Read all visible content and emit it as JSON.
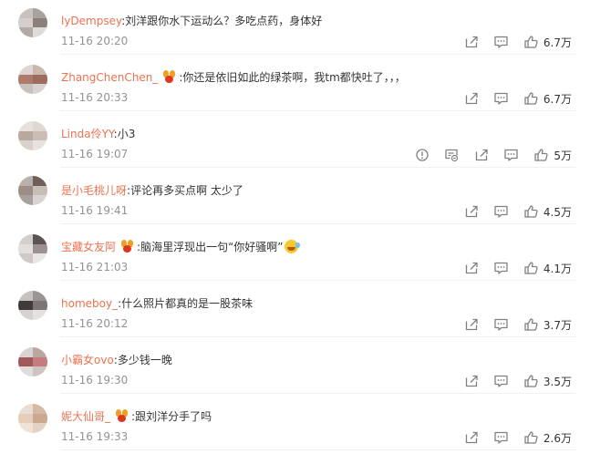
{
  "colors": {
    "username": "#eb7350",
    "text": "#333333",
    "time": "#939393",
    "icon": "#808080"
  },
  "comments": [
    {
      "username": "lyDempsey",
      "text": "刘洋跟你水下运动么？多吃点药，身体好",
      "time": "11-16 20:20",
      "likes": "6.7万",
      "badge": false,
      "avatar_colors": [
        "#c8c2bf",
        "#a9a19d",
        "#d4cfcc",
        "#8b807a",
        "#b3aaa5",
        "#e0dcd9"
      ]
    },
    {
      "username": "ZhangChenChen_",
      "text": "你还是依旧如此的绿茶啊，我tm都快吐了，，，",
      "time": "11-16 20:33",
      "likes": "6.7万",
      "badge": true,
      "avatar_colors": [
        "#ddd6d2",
        "#c9b8ad",
        "#b07a6a",
        "#9d6c5e",
        "#c7c1bd",
        "#d8d3d0"
      ]
    },
    {
      "username": "Linda伶YY",
      "text": "小3",
      "time": "11-16 19:07",
      "likes": "5万",
      "badge": false,
      "extra_actions": [
        "report-icon",
        "edit-icon"
      ],
      "avatar_colors": [
        "#e5e1de",
        "#ded7d2",
        "#b8a99f",
        "#cbbdb4",
        "#d9d1cb",
        "#e6e2df"
      ]
    },
    {
      "username": "是小毛桃儿呀",
      "text": "评论再多买点啊 太少了",
      "time": "11-16 19:41",
      "likes": "4.5万",
      "badge": false,
      "avatar_colors": [
        "#b9b0ab",
        "#6f5f58",
        "#9d8d86",
        "#c8beb8",
        "#a7a09c",
        "#d9d4d1"
      ]
    },
    {
      "username": "宝藏女友阿",
      "text": "脑海里浮现出一句“你好骚啊”",
      "emoji": true,
      "time": "11-16 21:03",
      "likes": "4.1万",
      "badge": true,
      "avatar_colors": [
        "#d3cfcc",
        "#5b5452",
        "#e2dfdc",
        "#9b9290",
        "#cfcac7",
        "#e9e7e5"
      ]
    },
    {
      "username": "homeboy_",
      "text": "什么照片都真的是一股茶味",
      "time": "11-16 20:12",
      "likes": "3.7万",
      "badge": false,
      "avatar_colors": [
        "#c6c2c0",
        "#9a9492",
        "#3f3b3a",
        "#7c7573",
        "#d6d2d0",
        "#e4e1df"
      ]
    },
    {
      "username": "小霸女ovo",
      "text": "多少钱一晚",
      "time": "11-16 19:30",
      "likes": "3.5万",
      "badge": false,
      "avatar_colors": [
        "#d8d4d2",
        "#b9a7a2",
        "#a0585a",
        "#c77c7c",
        "#e0dcda",
        "#cfc4c1"
      ]
    },
    {
      "username": "妮大仙哥_",
      "text": "跟刘洋分手了吗",
      "time": "11-16 19:33",
      "likes": "2.6万",
      "badge": true,
      "avatar_colors": [
        "#e8ddd5",
        "#d6b9a3",
        "#e6cdb9",
        "#c9a98f",
        "#efe2d6",
        "#e3d3c5"
      ]
    }
  ]
}
